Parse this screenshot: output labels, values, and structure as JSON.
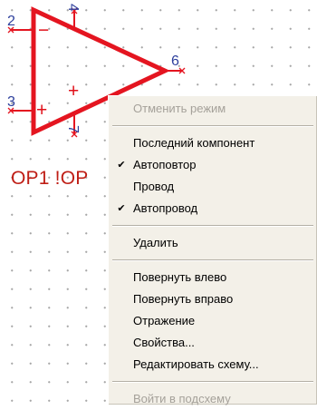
{
  "schematic": {
    "component_reference": "OP1 !OP",
    "pins": {
      "pin_2": "2",
      "pin_4": "4",
      "pin_6": "6",
      "pin_3": "3",
      "pin_7": "7"
    },
    "symbol": {
      "inverting_sign": "−",
      "noninverting_sign": "+",
      "supply_plus_sign": "+"
    },
    "colors": {
      "component_outline": "#e41520",
      "pin_numbers": "#2d3f9c",
      "reference_text": "#bf1e16",
      "grid_dots": "#a7a7a7"
    }
  },
  "context_menu": {
    "items": [
      {
        "label": "Отменить режим",
        "enabled": false,
        "checked": false
      },
      {
        "label": "Последний компонент",
        "enabled": true,
        "checked": false
      },
      {
        "label": "Автоповтор",
        "enabled": true,
        "checked": true
      },
      {
        "label": "Провод",
        "enabled": true,
        "checked": false
      },
      {
        "label": "Автопровод",
        "enabled": true,
        "checked": true
      },
      {
        "label": "Удалить",
        "enabled": true,
        "checked": false
      },
      {
        "label": "Повернуть влево",
        "enabled": true,
        "checked": false
      },
      {
        "label": "Повернуть вправо",
        "enabled": true,
        "checked": false
      },
      {
        "label": "Отражение",
        "enabled": true,
        "checked": false
      },
      {
        "label": "Свойства...",
        "enabled": true,
        "checked": false
      },
      {
        "label": "Редактировать схему...",
        "enabled": true,
        "checked": false
      },
      {
        "label": "Войти в подсхему",
        "enabled": false,
        "checked": false
      }
    ],
    "check_glyph": "✔"
  }
}
